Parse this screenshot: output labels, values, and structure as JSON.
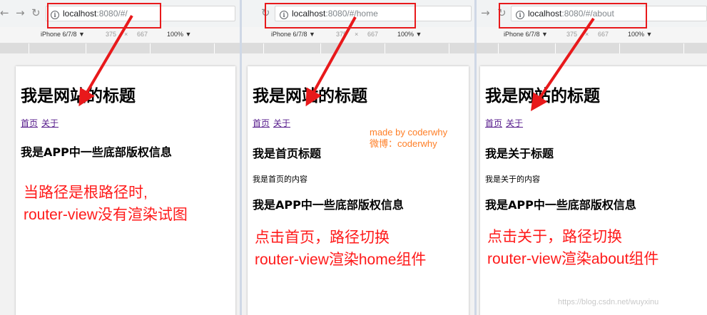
{
  "colors": {
    "annotation_red": "#ff1a1a",
    "arrow_red": "#e8191b",
    "credit_orange": "#ff7f27",
    "link_purple": "#551a8b"
  },
  "icons": {
    "back": "back-arrow-icon",
    "forward": "forward-arrow-icon",
    "reload": "reload-icon",
    "info": "info-circle-icon"
  },
  "panels": [
    {
      "url_host": "localhost",
      "url_path": ":8080/#/",
      "device": "iPhone 6/7/8 ▼",
      "width": "375",
      "times": "×",
      "height": "667",
      "zoom": "100% ▼",
      "page": {
        "title": "我是网站的标题",
        "link_home": "首页",
        "link_about": "关于",
        "footer": "我是APP中一些底部版权信息"
      },
      "annotation": [
        "当路径是根路径时,",
        "router-view没有渲染试图"
      ]
    },
    {
      "url_host": "localhost",
      "url_path": ":8080/#/home",
      "device": "iPhone 6/7/8 ▼",
      "width": "375",
      "times": "×",
      "height": "667",
      "zoom": "100% ▼",
      "page": {
        "title": "我是网站的标题",
        "link_home": "首页",
        "link_about": "关于",
        "heading": "我是首页标题",
        "content": "我是首页的内容",
        "footer": "我是APP中一些底部版权信息"
      },
      "credit": [
        "made by coderwhy",
        "微博：coderwhy"
      ],
      "annotation": [
        "点击首页，路径切换",
        "router-view渲染home组件"
      ]
    },
    {
      "url_host": "localhost",
      "url_path": ":8080/#/about",
      "device": "iPhone 6/7/8 ▼",
      "width": "375",
      "times": "×",
      "height": "667",
      "zoom": "100% ▼",
      "page": {
        "title": "我是网站的标题",
        "link_home": "首页",
        "link_about": "关于",
        "heading": "我是关于标题",
        "content": "我是关于的内容",
        "footer": "我是APP中一些底部版权信息"
      },
      "annotation": [
        "点击关于，路径切换",
        "router-view渲染about组件"
      ]
    }
  ],
  "watermark": "https://blog.csdn.net/wuyxinu"
}
